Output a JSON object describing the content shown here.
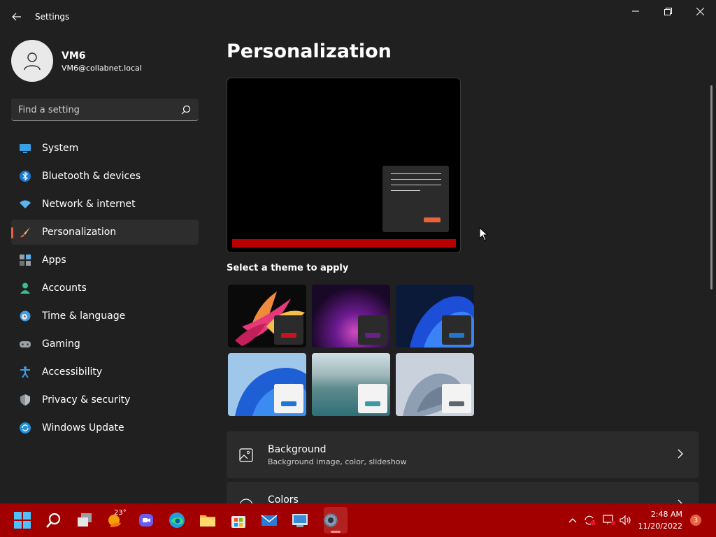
{
  "window": {
    "title": "Settings"
  },
  "user": {
    "name": "VM6",
    "email": "VM6@collabnet.local"
  },
  "search": {
    "placeholder": "Find a setting"
  },
  "sidebar": {
    "items": [
      {
        "label": "System",
        "icon": "monitor-icon",
        "active": false
      },
      {
        "label": "Bluetooth & devices",
        "icon": "bluetooth-icon",
        "active": false
      },
      {
        "label": "Network & internet",
        "icon": "wifi-icon",
        "active": false
      },
      {
        "label": "Personalization",
        "icon": "brush-icon",
        "active": true
      },
      {
        "label": "Apps",
        "icon": "apps-icon",
        "active": false
      },
      {
        "label": "Accounts",
        "icon": "person-icon",
        "active": false
      },
      {
        "label": "Time & language",
        "icon": "clock-globe-icon",
        "active": false
      },
      {
        "label": "Gaming",
        "icon": "gamepad-icon",
        "active": false
      },
      {
        "label": "Accessibility",
        "icon": "accessibility-icon",
        "active": false
      },
      {
        "label": "Privacy & security",
        "icon": "shield-icon",
        "active": false
      },
      {
        "label": "Windows Update",
        "icon": "update-icon",
        "active": false
      }
    ]
  },
  "main": {
    "title": "Personalization",
    "theme_heading": "Select a theme to apply",
    "themes": [
      {
        "name": "dark-flower",
        "accent": "#c4141c"
      },
      {
        "name": "glow",
        "accent": "#6b1f8c"
      },
      {
        "name": "windows-dark",
        "accent": "#1e78d2"
      },
      {
        "name": "windows-light",
        "accent": "#1e78d2"
      },
      {
        "name": "captured-motion",
        "accent": "#3a9aa6"
      },
      {
        "name": "sunrise",
        "accent": "#5f6670"
      }
    ],
    "cards": [
      {
        "title": "Background",
        "subtitle": "Background image, color, slideshow",
        "icon": "image-icon"
      },
      {
        "title": "Colors",
        "subtitle": "",
        "icon": "palette-icon"
      }
    ]
  },
  "taskbar": {
    "weather_temp": "23°",
    "time": "2:48 AM",
    "date": "11/20/2022",
    "notifications": "3",
    "color": "#a20000",
    "accent": "#e8633d"
  }
}
